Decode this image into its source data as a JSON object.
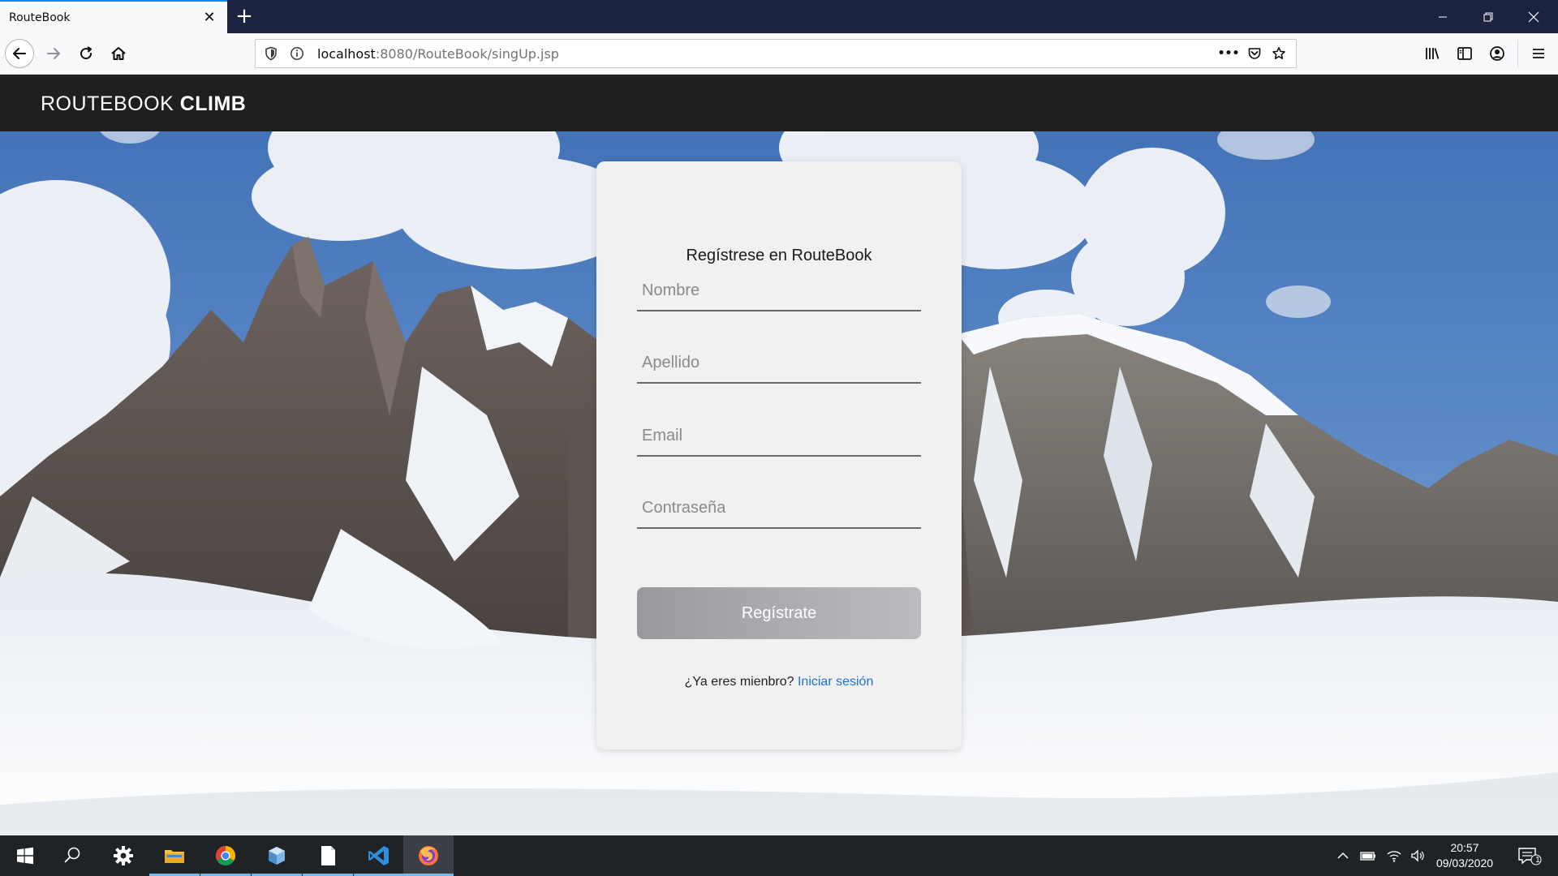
{
  "browser": {
    "tab_title": "RouteBook",
    "tab_close": "✕",
    "new_tab": "+",
    "url_host": "localhost",
    "url_path": ":8080/RouteBook/singUp.jsp",
    "page_actions": "•••"
  },
  "site": {
    "brand_part1": "ROUTEBOOK",
    "brand_part2": "CLIMB"
  },
  "signup": {
    "title": "Regístrese en RouteBook",
    "nombre_placeholder": "Nombre",
    "apellido_placeholder": "Apellido",
    "email_placeholder": "Email",
    "password_placeholder": "Contraseña",
    "submit_label": "Regístrate",
    "member_text": "¿Ya eres mienbro?",
    "login_link": "Iniciar sesión"
  },
  "taskbar": {
    "time": "20:57",
    "date": "09/03/2020",
    "notifications": "1"
  },
  "colors": {
    "browser_frame": "#1b2341",
    "header_bg": "#1f1f1f",
    "card_bg": "#f1f1f1",
    "link": "#1e73d9",
    "tab_accent": "#0a84ff"
  },
  "icons": {
    "back": "back-arrow-icon",
    "forward": "forward-arrow-icon",
    "reload": "reload-icon",
    "home": "home-icon",
    "shield": "tracking-shield-icon",
    "info": "info-icon",
    "pocket": "pocket-icon",
    "bookmark": "star-icon",
    "library": "library-icon",
    "sidebar": "sidebar-icon",
    "account": "account-icon",
    "menu": "hamburger-menu-icon"
  }
}
